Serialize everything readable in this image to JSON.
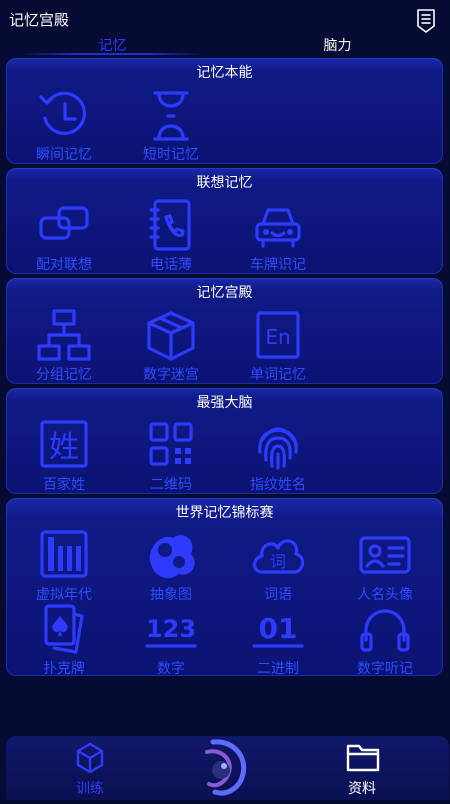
{
  "header": {
    "title": "记忆宫殿",
    "menu_icon": "list-menu-icon"
  },
  "tabs": [
    {
      "label": "记忆",
      "active": true
    },
    {
      "label": "脑力",
      "active": false
    }
  ],
  "colors": {
    "accent": "#2d3bff",
    "background": "#060b33",
    "panel": "#0f1a86"
  },
  "sections": [
    {
      "title": "记忆本能",
      "items": [
        {
          "label": "瞬间记忆",
          "icon": "history-clock-icon"
        },
        {
          "label": "短时记忆",
          "icon": "hourglass-icon"
        }
      ]
    },
    {
      "title": "联想记忆",
      "items": [
        {
          "label": "配对联想",
          "icon": "link-icon"
        },
        {
          "label": "电话薄",
          "icon": "phonebook-icon"
        },
        {
          "label": "车牌识记",
          "icon": "car-icon"
        }
      ]
    },
    {
      "title": "记忆宫殿",
      "items": [
        {
          "label": "分组记忆",
          "icon": "group-tree-icon"
        },
        {
          "label": "数字迷宫",
          "icon": "cube-icon"
        },
        {
          "label": "单词记忆",
          "icon": "english-word-icon",
          "glyph": "En"
        }
      ]
    },
    {
      "title": "最强大脑",
      "items": [
        {
          "label": "百家姓",
          "icon": "surname-icon",
          "glyph": "姓"
        },
        {
          "label": "二维码",
          "icon": "qr-code-icon"
        },
        {
          "label": "指纹姓名",
          "icon": "fingerprint-icon"
        }
      ]
    },
    {
      "title": "世界记忆锦标赛",
      "items": [
        {
          "label": "虚拟年代",
          "icon": "timeline-icon"
        },
        {
          "label": "抽象图",
          "icon": "abstract-shape-icon"
        },
        {
          "label": "词语",
          "icon": "word-cloud-icon",
          "glyph": "词"
        },
        {
          "label": "人名头像",
          "icon": "id-card-icon"
        },
        {
          "label": "扑克牌",
          "icon": "playing-cards-icon"
        },
        {
          "label": "数字",
          "icon": "numbers-icon",
          "glyph": "123"
        },
        {
          "label": "二进制",
          "icon": "binary-icon",
          "glyph": "01"
        },
        {
          "label": "数字听记",
          "icon": "headphones-icon"
        }
      ]
    }
  ],
  "bottom_nav": [
    {
      "label": "训练",
      "icon": "training-cube-icon",
      "active": true
    },
    {
      "label": "资料",
      "icon": "folder-icon",
      "active": false
    }
  ]
}
